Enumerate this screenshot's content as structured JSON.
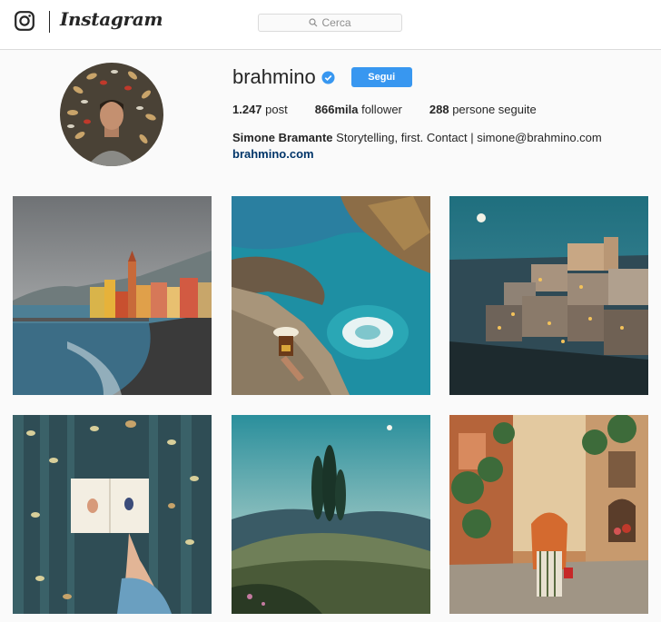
{
  "nav": {
    "logo_text": "Instagram",
    "search_placeholder": "Cerca"
  },
  "profile": {
    "username": "brahmino",
    "verified": true,
    "follow_label": "Segui",
    "stats": [
      {
        "count": "1.247",
        "label": "post"
      },
      {
        "count": "866mila",
        "label": "follower"
      },
      {
        "count": "288",
        "label": "persone seguite"
      }
    ],
    "bio_name": "Simone Bramante",
    "bio_text": "Storytelling, first. Contact | simone@brahmino.com",
    "website": "brahmino.com"
  },
  "colors": {
    "accent": "#3897f0",
    "link": "#003569",
    "border": "#dbdbdb"
  },
  "posts": [
    {
      "subject": "coastal-village-photo"
    },
    {
      "subject": "sea-pool-woman-hat-photo"
    },
    {
      "subject": "hilltop-town-night-photo"
    },
    {
      "subject": "open-book-flatlay-photo"
    },
    {
      "subject": "cypress-hill-photo"
    },
    {
      "subject": "woman-alley-photo"
    }
  ]
}
